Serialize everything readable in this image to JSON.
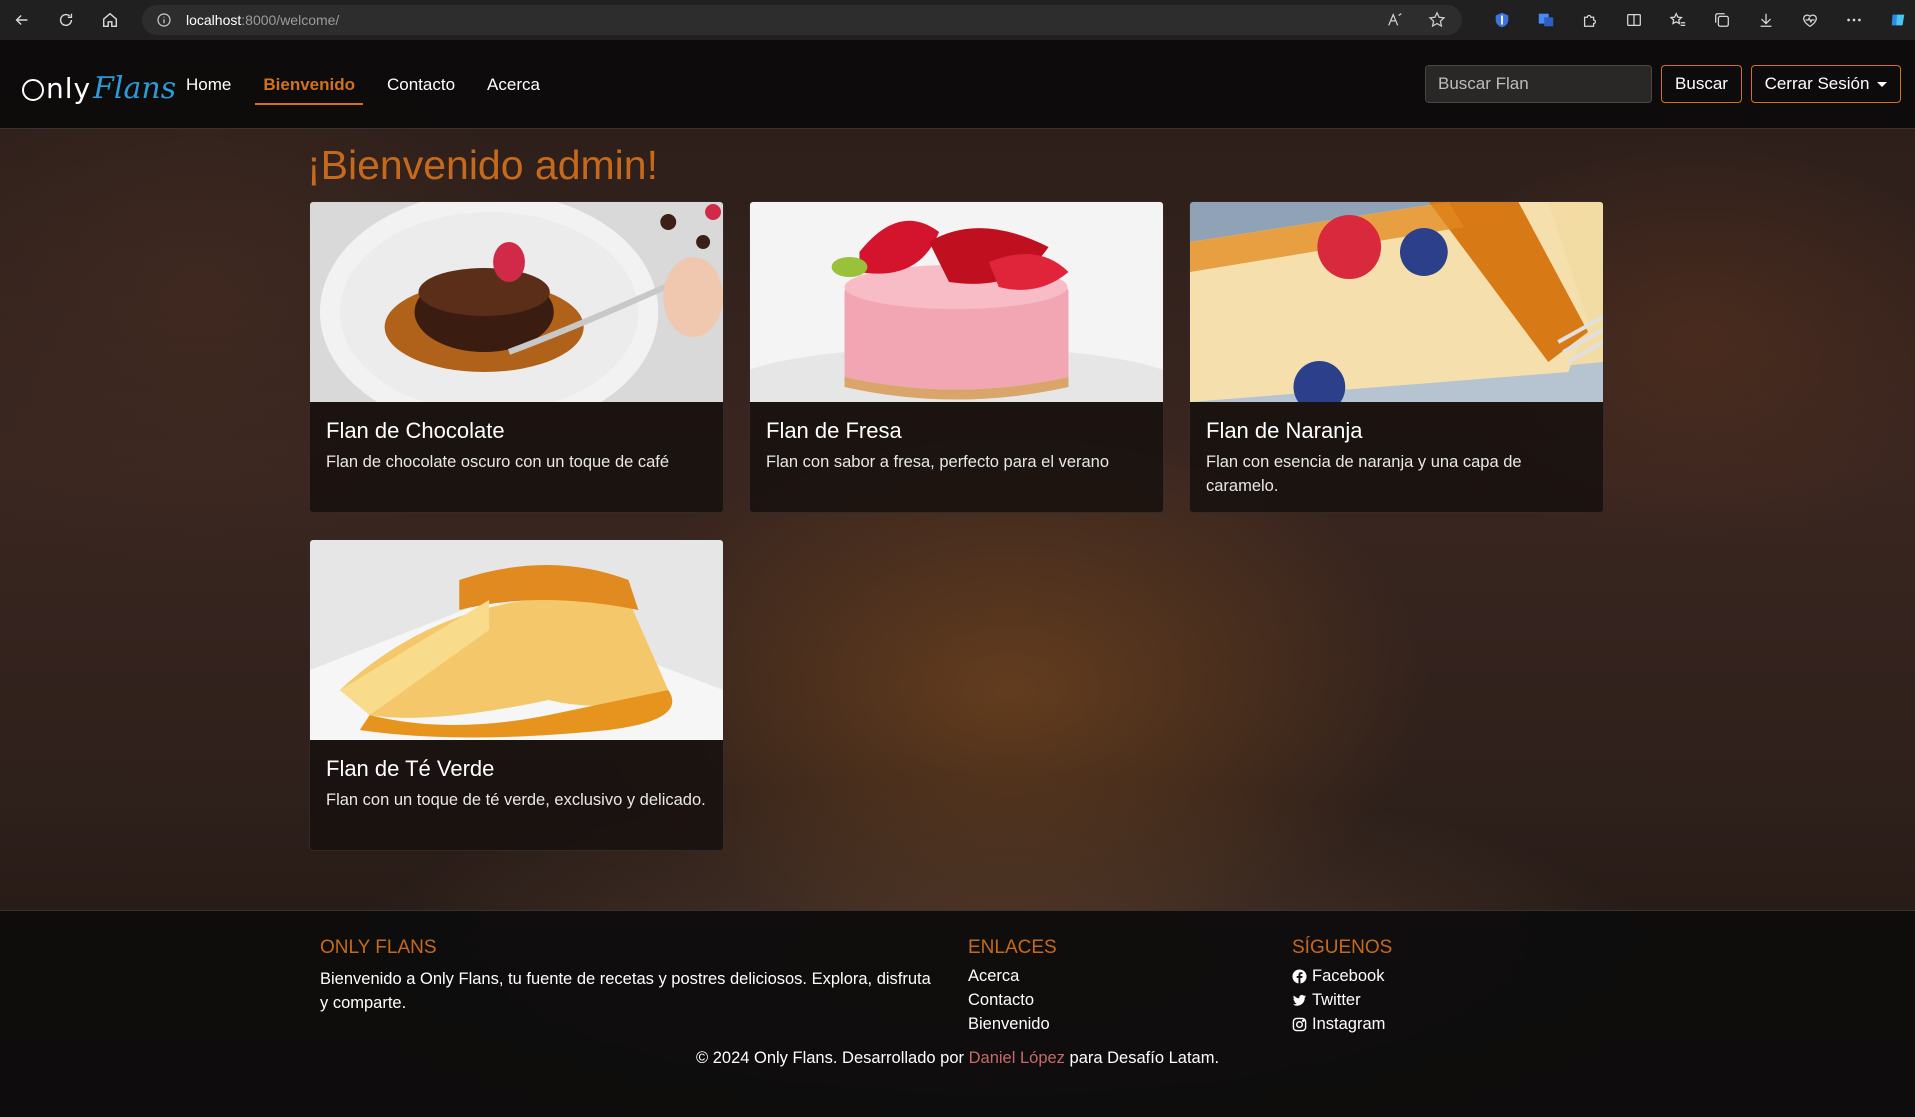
{
  "browser": {
    "url_host": "localhost",
    "url_rest": ":8000/welcome/"
  },
  "navbar": {
    "brand_only": "nly",
    "brand_flans": "Flans",
    "links": [
      "Home",
      "Bienvenido",
      "Contacto",
      "Acerca"
    ],
    "active_link": "Bienvenido",
    "search_placeholder": "Buscar Flan",
    "search_button": "Buscar",
    "logout_button": "Cerrar Sesión"
  },
  "welcome_title": "¡Bienvenido admin!",
  "flans": [
    {
      "title": "Flan de Chocolate",
      "description": "Flan de chocolate oscuro con un toque de café"
    },
    {
      "title": "Flan de Fresa",
      "description": "Flan con sabor a fresa, perfecto para el verano"
    },
    {
      "title": "Flan de Naranja",
      "description": "Flan con esencia de naranja y una capa de caramelo."
    },
    {
      "title": "Flan de Té Verde",
      "description": "Flan con un toque de té verde, exclusivo y delicado."
    }
  ],
  "footer": {
    "about_heading": "ONLY FLANS",
    "about_text": "Bienvenido a Only Flans, tu fuente de recetas y postres deliciosos. Explora, disfruta y comparte.",
    "links_heading": "ENLACES",
    "links": [
      "Acerca",
      "Contacto",
      "Bienvenido"
    ],
    "social_heading": "SÍGUENOS",
    "social": [
      "Facebook",
      "Twitter",
      "Instagram"
    ],
    "copyright_prefix": "© 2024 Only Flans. Desarrollado por",
    "author": "Daniel López",
    "copyright_suffix": "para Desafío Latam."
  },
  "colors": {
    "accent": "#d3711c",
    "brand_blue": "#2c9ad6",
    "author_link": "#c86a6a"
  }
}
